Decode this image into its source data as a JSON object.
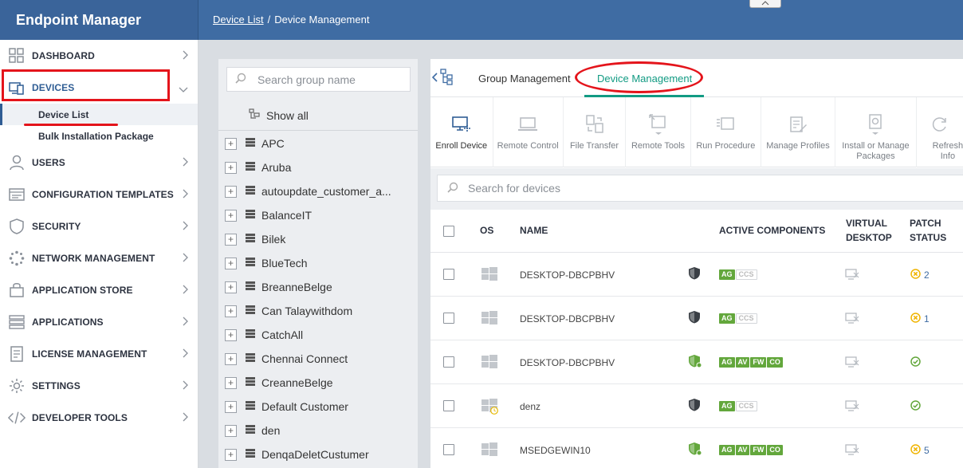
{
  "app": {
    "title": "Endpoint Manager"
  },
  "breadcrumb": {
    "parent": "Device List",
    "separator": "/",
    "current": "Device Management"
  },
  "sidebar": {
    "items": [
      {
        "label": "DASHBOARD",
        "icon": "dashboard-icon"
      },
      {
        "label": "DEVICES",
        "icon": "devices-icon",
        "active": true,
        "subitems": [
          {
            "label": "Device List",
            "active": true
          },
          {
            "label": "Bulk Installation Package"
          }
        ]
      },
      {
        "label": "USERS",
        "icon": "user-icon"
      },
      {
        "label": "CONFIGURATION TEMPLATES",
        "icon": "configuration-icon"
      },
      {
        "label": "SECURITY",
        "icon": "shield-icon"
      },
      {
        "label": "NETWORK MANAGEMENT",
        "icon": "network-icon"
      },
      {
        "label": "APPLICATION STORE",
        "icon": "store-icon"
      },
      {
        "label": "APPLICATIONS",
        "icon": "applications-icon"
      },
      {
        "label": "LICENSE MANAGEMENT",
        "icon": "license-icon"
      },
      {
        "label": "SETTINGS",
        "icon": "gear-icon"
      },
      {
        "label": "DEVELOPER TOOLS",
        "icon": "code-icon"
      }
    ]
  },
  "groups": {
    "search_placeholder": "Search group name",
    "show_all": "Show all",
    "items": [
      "APC",
      "Aruba",
      "autoupdate_customer_a...",
      "BalanceIT",
      "Bilek",
      "BlueTech",
      "BreanneBelge",
      "Can Talaywithdom",
      "CatchAll",
      "Chennai Connect",
      "CreanneBelge",
      "Default Customer",
      "den",
      "DenqaDeletCustumer"
    ]
  },
  "tabs": {
    "group_management": "Group Management",
    "device_management": "Device Management",
    "active": "device_management"
  },
  "toolbar": {
    "enroll_device": "Enroll Device",
    "remote_control": "Remote Control",
    "file_transfer": "File Transfer",
    "remote_tools": "Remote Tools",
    "run_procedure": "Run Procedure",
    "manage_profiles": "Manage Profiles",
    "install_manage_packages": "Install or Manage Packages",
    "refresh_info": "Refresh Info"
  },
  "device_search": {
    "placeholder": "Search for devices"
  },
  "table": {
    "headers": {
      "os": "OS",
      "name": "NAME",
      "active_components": "ACTIVE COMPONENTS",
      "virtual_desktop": "VIRTUAL DESKTOP",
      "patch_status": "PATCH STATUS"
    },
    "rows": [
      {
        "name": "DESKTOP-DBCPBHV",
        "shield": "dark",
        "components": [
          [
            "AG",
            true
          ],
          [
            "CCS",
            false
          ]
        ],
        "patch": "2",
        "patch_state": "warning"
      },
      {
        "name": "DESKTOP-DBCPBHV",
        "shield": "dark",
        "components": [
          [
            "AG",
            true
          ],
          [
            "CCS",
            false
          ]
        ],
        "patch": "1",
        "patch_state": "warning"
      },
      {
        "name": "DESKTOP-DBCPBHV",
        "shield": "green",
        "components": [
          [
            "AG",
            true
          ],
          [
            "AV",
            true
          ],
          [
            "FW",
            true
          ],
          [
            "CO",
            true
          ]
        ],
        "patch": "",
        "patch_state": "ok"
      },
      {
        "name": "denz",
        "shield": "dark",
        "components": [
          [
            "AG",
            true
          ],
          [
            "CCS",
            false
          ]
        ],
        "patch": "",
        "patch_state": "ok"
      },
      {
        "name": "MSEDGEWIN10",
        "shield": "green",
        "components": [
          [
            "AG",
            true
          ],
          [
            "AV",
            true
          ],
          [
            "FW",
            true
          ],
          [
            "CO",
            true
          ]
        ],
        "patch": "5",
        "patch_state": "warning"
      }
    ]
  },
  "colors": {
    "header": "#3f6ca3",
    "accent_teal": "#129b83",
    "badge_green": "#63a73c",
    "warning": "#f0b400",
    "annotation_red": "#e4141b"
  }
}
